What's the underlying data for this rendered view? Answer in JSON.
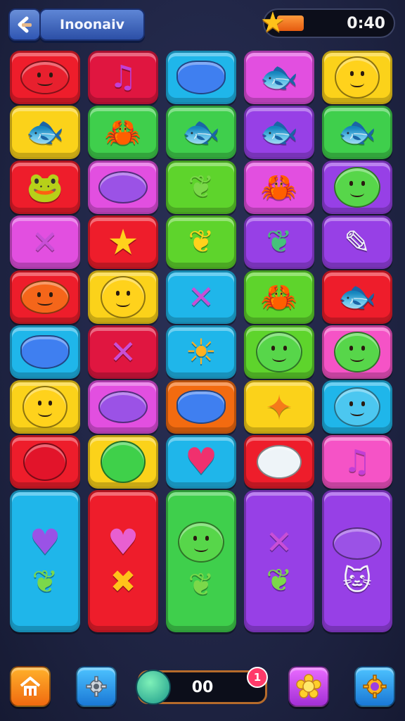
{
  "header": {
    "back_icon": "back-arrow-icon",
    "title": "Inoonaiv",
    "timer_value": "0:40",
    "timer_fill_fraction": 0.25,
    "timer_icon": "star-icon"
  },
  "colors": {
    "red": "#ee1d2b",
    "crimson": "#e01640",
    "cyan": "#1fb6ea",
    "magenta": "#e24fe0",
    "yellow": "#fbd21a",
    "green": "#3fcf4c",
    "lime": "#5ed42c",
    "purple": "#9740e6",
    "orange": "#f36b10",
    "pink": "#f553c6"
  },
  "board": {
    "columns": [
      [
        {
          "color": "red",
          "h": 1,
          "items": [
            {
              "icon": "red-blob-face-icon"
            }
          ]
        },
        {
          "color": "yellow",
          "h": 1,
          "items": [
            {
              "icon": "orange-fish-icon"
            }
          ]
        },
        {
          "color": "red",
          "h": 1,
          "items": [
            {
              "icon": "green-frog-icon"
            }
          ]
        },
        {
          "color": "magenta",
          "h": 1,
          "items": [
            {
              "icon": "crossed-wands-icon"
            }
          ]
        },
        {
          "color": "red",
          "h": 1,
          "items": [
            {
              "icon": "orange-blob-face-icon"
            }
          ]
        },
        {
          "color": "cyan",
          "h": 1,
          "items": [
            {
              "icon": "blue-heart-gem-icon"
            }
          ]
        },
        {
          "color": "yellow",
          "h": 1,
          "items": [
            {
              "icon": "smiley-face-icon"
            }
          ]
        },
        {
          "color": "red",
          "h": 1,
          "items": [
            {
              "icon": "red-balloon-icon"
            }
          ]
        },
        {
          "color": "cyan",
          "h": 2,
          "items": [
            {
              "icon": "purple-heart-icon"
            },
            {
              "icon": "leaf-icon"
            }
          ]
        }
      ],
      [
        {
          "color": "crimson",
          "h": 1,
          "items": [
            {
              "icon": "music-note-icon"
            }
          ]
        },
        {
          "color": "green",
          "h": 1,
          "items": [
            {
              "icon": "orange-crab-icon"
            }
          ]
        },
        {
          "color": "magenta",
          "h": 1,
          "items": [
            {
              "icon": "purple-blob-icon"
            }
          ]
        },
        {
          "color": "red",
          "h": 1,
          "items": [
            {
              "icon": "star-icon"
            }
          ]
        },
        {
          "color": "yellow",
          "h": 1,
          "items": [
            {
              "icon": "smiley-face-icon"
            }
          ]
        },
        {
          "color": "crimson",
          "h": 1,
          "items": [
            {
              "icon": "crossed-wands-icon"
            }
          ]
        },
        {
          "color": "magenta",
          "h": 1,
          "items": [
            {
              "icon": "purple-blob-icon"
            }
          ]
        },
        {
          "color": "yellow",
          "h": 1,
          "items": [
            {
              "icon": "green-ball-icon"
            }
          ]
        },
        {
          "color": "red",
          "h": 2,
          "items": [
            {
              "icon": "pink-lollipop-icon"
            },
            {
              "icon": "orange-x-icon"
            }
          ]
        }
      ],
      [
        {
          "color": "cyan",
          "h": 1,
          "items": [
            {
              "icon": "blue-heart-gem-icon"
            }
          ]
        },
        {
          "color": "green",
          "h": 1,
          "items": [
            {
              "icon": "orange-fish-icon"
            }
          ]
        },
        {
          "color": "lime",
          "h": 1,
          "items": [
            {
              "icon": "leaf-icon"
            }
          ]
        },
        {
          "color": "lime",
          "h": 1,
          "items": [
            {
              "icon": "yellow-leaf-icon"
            }
          ]
        },
        {
          "color": "cyan",
          "h": 1,
          "items": [
            {
              "icon": "crossed-wands-icon"
            }
          ]
        },
        {
          "color": "cyan",
          "h": 1,
          "items": [
            {
              "icon": "sun-icon"
            }
          ]
        },
        {
          "color": "orange",
          "h": 1,
          "items": [
            {
              "icon": "blue-heart-gem-icon"
            }
          ]
        },
        {
          "color": "cyan",
          "h": 1,
          "items": [
            {
              "icon": "pink-heart-icon"
            }
          ]
        },
        {
          "color": "green",
          "h": 2,
          "items": [
            {
              "icon": "green-blob-face-icon"
            },
            {
              "icon": "leaf-icon"
            }
          ]
        }
      ],
      [
        {
          "color": "magenta",
          "h": 1,
          "items": [
            {
              "icon": "purple-fish-icon"
            }
          ]
        },
        {
          "color": "purple",
          "h": 1,
          "items": [
            {
              "icon": "purple-fish-icon"
            }
          ]
        },
        {
          "color": "magenta",
          "h": 1,
          "items": [
            {
              "icon": "yellow-crab-icon"
            }
          ]
        },
        {
          "color": "purple",
          "h": 1,
          "items": [
            {
              "icon": "green-leaf-icon"
            }
          ]
        },
        {
          "color": "lime",
          "h": 1,
          "items": [
            {
              "icon": "orange-crab-icon"
            }
          ]
        },
        {
          "color": "lime",
          "h": 1,
          "items": [
            {
              "icon": "green-blob-face-icon"
            }
          ]
        },
        {
          "color": "yellow",
          "h": 1,
          "items": [
            {
              "icon": "wrapped-candy-icon"
            }
          ]
        },
        {
          "color": "red",
          "h": 1,
          "items": [
            {
              "icon": "white-shell-icon"
            }
          ]
        },
        {
          "color": "purple",
          "h": 2,
          "items": [
            {
              "icon": "crossed-wands-icon"
            },
            {
              "icon": "leaf-icon"
            }
          ]
        }
      ],
      [
        {
          "color": "yellow",
          "h": 1,
          "items": [
            {
              "icon": "smiley-face-icon"
            }
          ]
        },
        {
          "color": "green",
          "h": 1,
          "items": [
            {
              "icon": "orange-fish-icon"
            }
          ]
        },
        {
          "color": "purple",
          "h": 1,
          "items": [
            {
              "icon": "green-blob-face-icon"
            }
          ]
        },
        {
          "color": "purple",
          "h": 1,
          "items": [
            {
              "icon": "pencil-icon"
            }
          ]
        },
        {
          "color": "red",
          "h": 1,
          "items": [
            {
              "icon": "blue-fish-icon"
            }
          ]
        },
        {
          "color": "pink",
          "h": 1,
          "items": [
            {
              "icon": "green-blob-face-icon"
            }
          ]
        },
        {
          "color": "cyan",
          "h": 1,
          "items": [
            {
              "icon": "blue-blob-face-icon"
            }
          ]
        },
        {
          "color": "pink",
          "h": 1,
          "items": [
            {
              "icon": "music-note-icon"
            }
          ]
        },
        {
          "color": "purple",
          "h": 2,
          "items": [
            {
              "icon": "purple-blob-icon"
            },
            {
              "icon": "white-cat-icon"
            }
          ]
        }
      ]
    ]
  },
  "footer": {
    "home_icon": "home-icon",
    "settings_icon": "gear-icon",
    "score_value": "00",
    "score_badge": "1",
    "score_icon": "coin-icon",
    "flower_icon": "flower-icon",
    "options_icon": "cog-icon"
  }
}
